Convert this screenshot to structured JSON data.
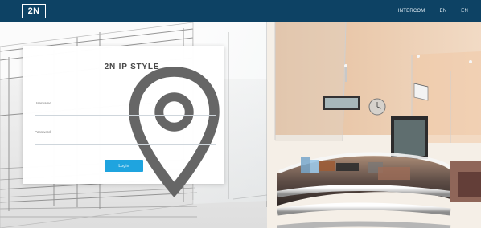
{
  "header": {
    "brand_label": "2N",
    "nav_items": [
      "INTERCOM",
      "EN",
      "EN"
    ]
  },
  "login": {
    "product_title": "2N IP STYLE",
    "username_label": "Username",
    "password_label": "Password",
    "login_button": "Login"
  },
  "colors": {
    "header_bg": "#0d4264",
    "button_bg": "#1fa4df"
  },
  "icons": {
    "brand_pin": "location-pin-icon"
  }
}
